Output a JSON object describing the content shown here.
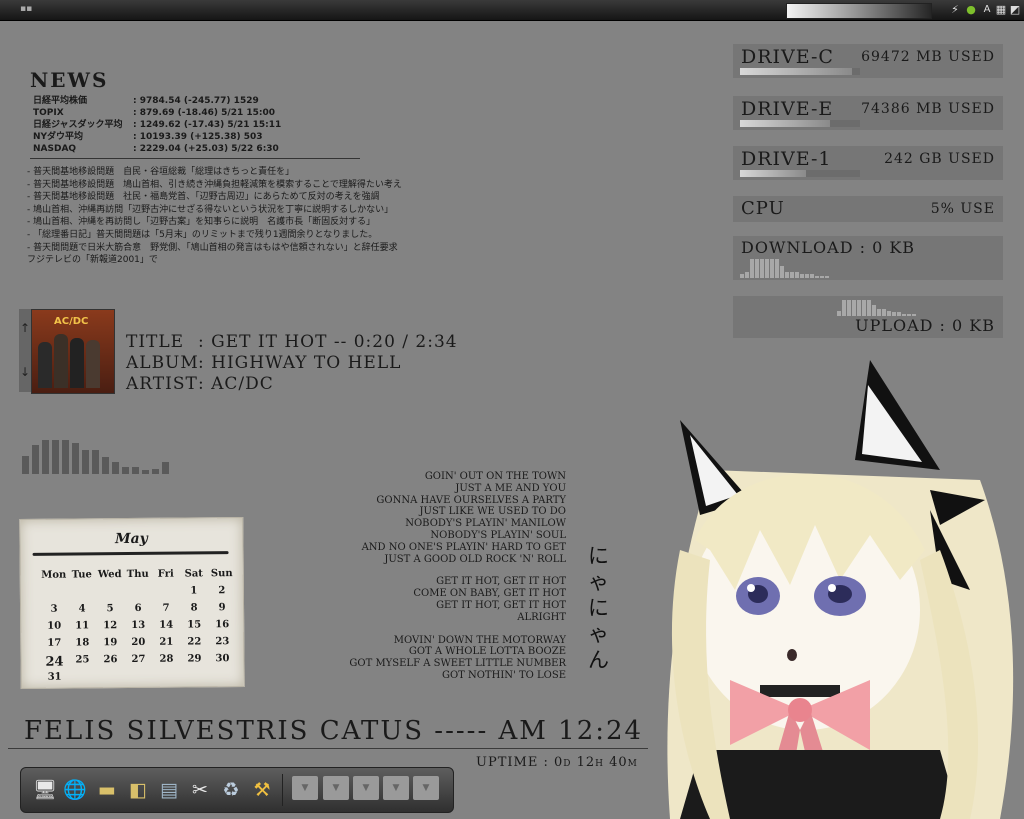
{
  "colors": {
    "desktop_bg": "#838383",
    "text": "#1a1a1a",
    "panel": "#1f1f1f"
  },
  "top_panel": {
    "tray_icons": [
      "flash-icon",
      "leaf-icon",
      "keyboard-layout-icon",
      "volume-icon",
      "network-icon"
    ],
    "keyboard_label": "A"
  },
  "news": {
    "title": "NEWS",
    "rows": [
      {
        "name": "日経平均株価",
        "value": ": 9784.54 (-245.77) 1529"
      },
      {
        "name": "TOPIX",
        "value": ": 879.69 (-18.46) 5/21 15:00"
      },
      {
        "name": "日経ジャスダック平均",
        "value": ": 1249.62 (-17.43) 5/21 15:11"
      },
      {
        "name": "NYダウ平均",
        "value": ": 10193.39 (+125.38) 503"
      },
      {
        "name": "NASDAQ",
        "value": ": 2229.04 (+25.03) 5/22 6:30"
      }
    ],
    "headlines": [
      "- 普天間基地移設問題　自民・谷垣総裁「総理はきちっと責任を」",
      "- 普天間基地移設問題　鳩山首相、引き続き沖縄負担軽減策を模索することで理解得たい考え",
      "- 普天間基地移設問題　社民・福島党首、「辺野古周辺」にあらためて反対の考えを強調",
      "- 鳩山首相、沖縄再訪問「辺野古沖にせざる得ないという状況を丁寧に説明するしかない」",
      "- 鳩山首相、沖縄を再訪問し「辺野古案」を知事らに説明　名護市長「断固反対する」",
      "- 「総理番日記」普天間問題は「5月末」のリミットまで残り1週間余りとなりました。",
      "- 普天間問題で日米大筋合意　野党側、「鳩山首相の発言はもはや信頼されない」と辞任要求",
      "フジテレビの「新報道2001」で"
    ]
  },
  "system": {
    "drive_c": {
      "label": "DRIVE-C",
      "value": "69472 MB USED",
      "level": 0.93
    },
    "drive_e": {
      "label": "DRIVE-E",
      "value": "74386 MB USED",
      "level": 0.75
    },
    "drive_1": {
      "label": "DRIVE-1",
      "value": "242 GB USED",
      "level": 0.55
    },
    "cpu": {
      "label": "CPU",
      "value": "5% USE"
    },
    "download": {
      "label": "DOWNLOAD : 0 KB",
      "graph": [
        0.2,
        0.3,
        0.95,
        0.95,
        0.95,
        0.95,
        0.95,
        0.95,
        0.6,
        0.3,
        0.3,
        0.3,
        0.2,
        0.2,
        0.2,
        0.1,
        0.1,
        0.1
      ]
    },
    "upload": {
      "label": "UPLOAD : 0 KB",
      "graph": [
        0.3,
        0.9,
        0.9,
        0.9,
        0.9,
        0.9,
        0.9,
        0.6,
        0.4,
        0.4,
        0.3,
        0.2,
        0.2,
        0.1,
        0.1,
        0.1
      ]
    }
  },
  "now_playing": {
    "album_art_label": "AC/DC",
    "scroll_up": "↑",
    "scroll_down": "↓",
    "title_key": "TITLE",
    "title_value": ": GET IT HOT -- 0:20 / 2:34",
    "album_key": "ALBUM",
    "album_value": ": HIGHWAY TO HELL",
    "artist_key": "ARTIST",
    "artist_value": ": AC/DC",
    "spectrum": [
      0.4,
      0.65,
      0.78,
      0.78,
      0.78,
      0.7,
      0.55,
      0.55,
      0.38,
      0.28,
      0.15,
      0.15,
      0.1,
      0.12,
      0.28
    ]
  },
  "calendar": {
    "month": "May",
    "weekdays": [
      "Mon",
      "Tue",
      "Wed",
      "Thu",
      "Fri",
      "Sat",
      "Sun"
    ],
    "weeks": [
      [
        "",
        "",
        "",
        "",
        "",
        "1",
        "2"
      ],
      [
        "3",
        "4",
        "5",
        "6",
        "7",
        "8",
        "9"
      ],
      [
        "10",
        "11",
        "12",
        "13",
        "14",
        "15",
        "16"
      ],
      [
        "17",
        "18",
        "19",
        "20",
        "21",
        "22",
        "23"
      ],
      [
        "24",
        "25",
        "26",
        "27",
        "28",
        "29",
        "30"
      ],
      [
        "31",
        "",
        "",
        "",
        "",
        "",
        ""
      ]
    ],
    "today": "24"
  },
  "lyrics": [
    "GOIN' OUT ON THE TOWN",
    "JUST A ME AND YOU",
    "GONNA HAVE OURSELVES A PARTY",
    "JUST LIKE WE USED TO DO",
    "NOBODY'S PLAYIN' MANILOW",
    "NOBODY'S PLAYIN' SOUL",
    "AND NO ONE'S PLAYIN' HARD TO GET",
    "JUST A GOOD OLD ROCK 'N' ROLL",
    "",
    "GET IT HOT, GET IT HOT",
    "COME ON BABY, GET IT HOT",
    "GET IT HOT, GET IT HOT",
    "ALRIGHT",
    "",
    "MOVIN' DOWN THE MOTORWAY",
    "GOT A WHOLE LOTTA BOOZE",
    "GOT MYSELF A SWEET LITTLE NUMBER",
    "GOT NOTHIN' TO LOSE"
  ],
  "nyan_text": "にゃにゃん",
  "clock_line": "FELIS SILVESTRIS CATUS ----- AM 12:24",
  "uptime": "UPTIME : 0d 12h 40m",
  "dock": {
    "icons": [
      "computer-icon",
      "browser-icon",
      "folder-icon",
      "open-folder-icon",
      "file-manager-icon",
      "tools-icon",
      "trash-icon",
      "hammer-icon"
    ],
    "slots": 5
  }
}
